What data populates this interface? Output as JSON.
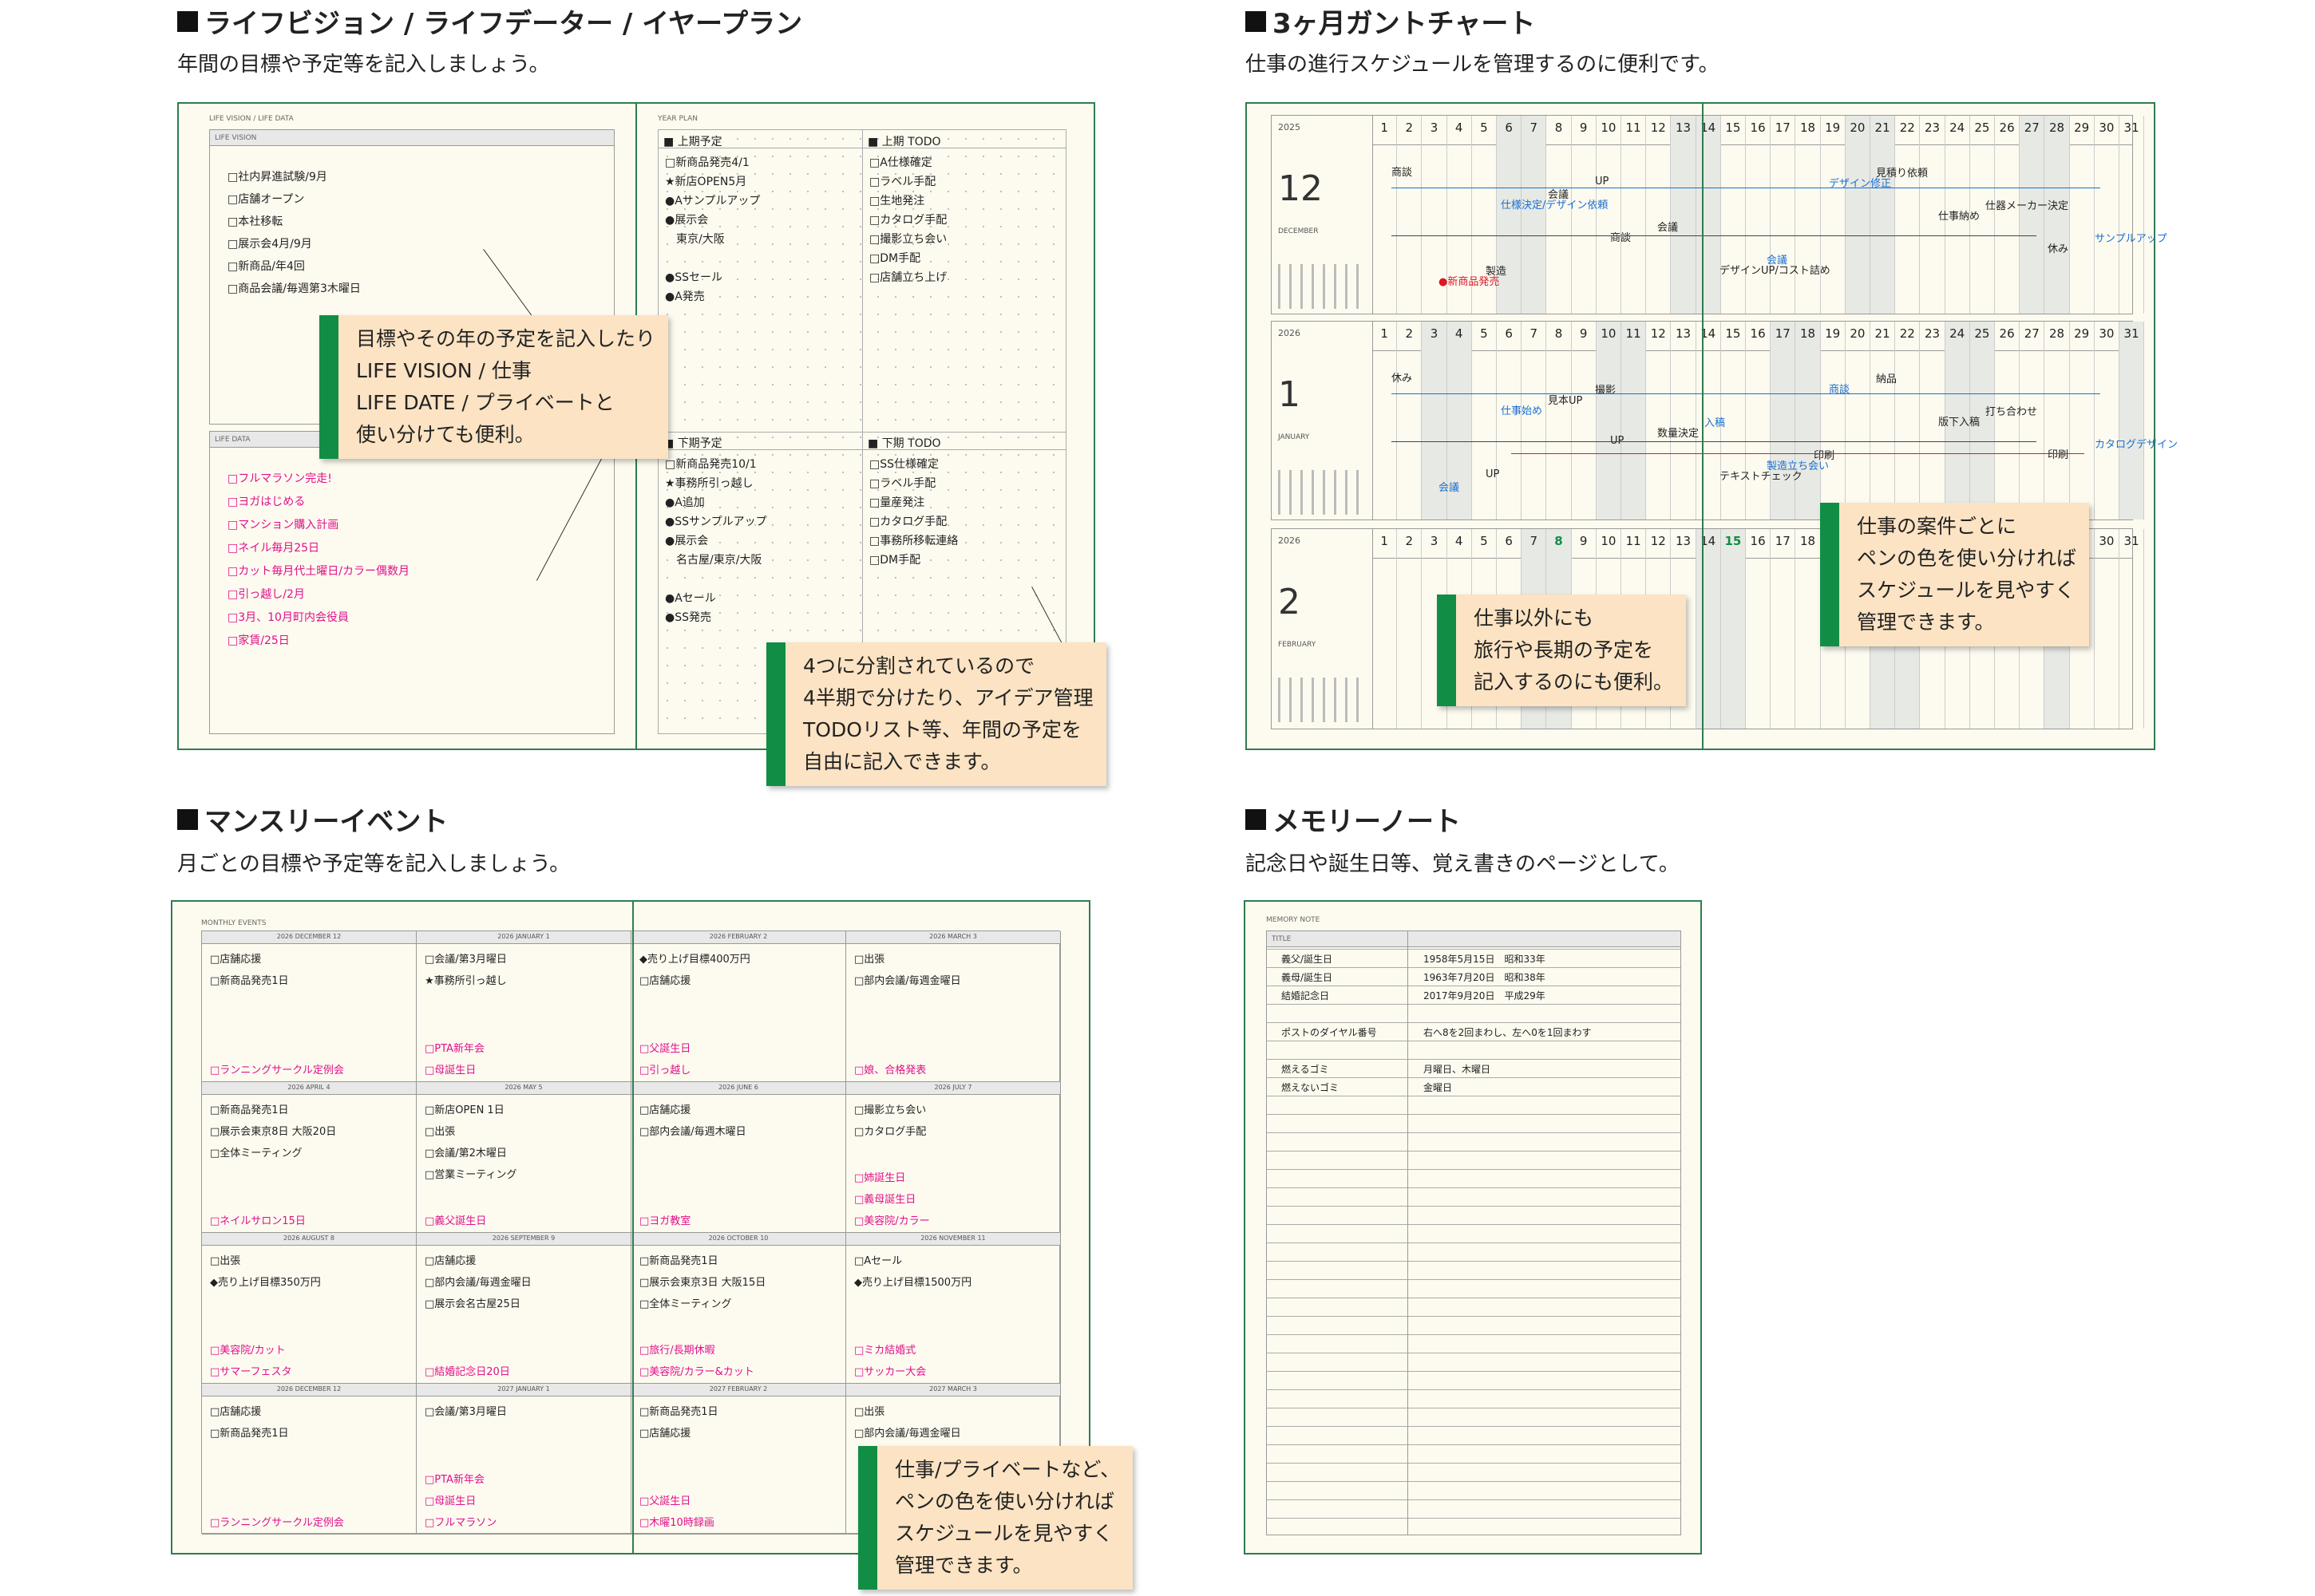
{
  "sections": {
    "life": {
      "title": "ライフビジョン / ライフデーター / イヤープラン",
      "subtitle": "年間の目標や予定等を記入しましょう。"
    },
    "gantt": {
      "title": "3ヶ月ガントチャート",
      "subtitle": "仕事の進行スケジュールを管理するのに便利です。"
    },
    "monthly": {
      "title": "マンスリーイベント",
      "subtitle": "月ごとの目標や予定等を記入しましょう。"
    },
    "memory": {
      "title": "メモリーノート",
      "subtitle": "記念日や誕生日等、覚え書きのページとして。"
    }
  },
  "life_book": {
    "left_header": "LIFE VISION / LIFE DATA",
    "vision_label": "LIFE VISION",
    "vision_items": [
      "□社内昇進試験/9月",
      "□店舗オープン",
      "□本社移転",
      "□展示会4月/9月",
      "□新商品/年4回",
      "□商品会議/毎週第3木曜日"
    ],
    "data_label": "LIFE DATA",
    "data_items": [
      "□フルマラソン完走!",
      "□ヨガはじめる",
      "□マンション購入計画",
      "□ネイル毎月25日",
      "□カット毎月代土曜日/カラー偶数月",
      "□引っ越し/2月",
      "□3月、10月町内会役員",
      "□家賃/25日"
    ],
    "right_header": "YEAR PLAN",
    "q1": "上期予定",
    "q2": "上期 TODO",
    "q3": "下期予定",
    "q4": "下期 TODO",
    "q1_items": [
      "□新商品発売4/1",
      "★新店OPEN5月",
      "●Aサンプルアップ",
      "●展示会",
      "　東京/大阪",
      "",
      "●SSセール",
      "●A発売"
    ],
    "q2_items": [
      "□A仕様確定",
      "□ラベル手配",
      "□生地発注",
      "□カタログ手配",
      "□撮影立ち会い",
      "□DM手配",
      "□店舗立ち上げ"
    ],
    "q3_items": [
      "□新商品発売10/1",
      "★事務所引っ越し",
      "●A追加",
      "●SSサンプルアップ",
      "●展示会",
      "　名古屋/東京/大阪",
      "",
      "●Aセール",
      "●SS発売"
    ],
    "q4_items": [
      "□SS仕様確定",
      "□ラベル手配",
      "□量産発注",
      "□カタログ手配",
      "□事務所移転連絡",
      "□DM手配"
    ],
    "callout1": [
      "目標やその年の予定を記入したり",
      "LIFE VISION / 仕事",
      "LIFE DATE / プライベートと",
      "使い分けても便利。"
    ],
    "callout2": [
      "4つに分割されているので",
      "4半期で分けたり、アイデア管理",
      "TODOリスト等、年間の予定を",
      "自由に記入できます。"
    ]
  },
  "gantt_book": {
    "months": [
      {
        "year": "2025",
        "num": "12",
        "name": "DECEMBER"
      },
      {
        "year": "2026",
        "num": "1",
        "name": "JANUARY"
      },
      {
        "year": "2026",
        "num": "2",
        "name": "FEBRUARY"
      }
    ],
    "days": [
      "1",
      "2",
      "3",
      "4",
      "5",
      "6",
      "7",
      "8",
      "9",
      "10",
      "11",
      "12",
      "13",
      "14",
      "15",
      "16",
      "17",
      "18",
      "19",
      "20",
      "21",
      "22",
      "23",
      "24",
      "25",
      "26",
      "27",
      "28",
      "29",
      "30",
      "31"
    ],
    "row1_notes": [
      "商談",
      "仕様決定/デザイン依頼",
      "商談",
      "デザインUP/コスト詰め",
      "デザイン修正",
      "仕事納め",
      "休み",
      "●新商品発売",
      "会議",
      "会議",
      "会議",
      "見積り依頼",
      "仕器メーカー決定",
      "サンプルアップ",
      "製造",
      "UP"
    ],
    "row2_notes": [
      "休み",
      "仕事始め",
      "UP",
      "テキストチェック",
      "商談",
      "版下入稿",
      "印刷",
      "会議",
      "見本UP",
      "数量決定",
      "製造立ち会い",
      "納品",
      "打ち合わせ",
      "カタログデザイン",
      "UP",
      "撮影",
      "入稿",
      "印刷"
    ],
    "callout1": [
      "仕事以外にも",
      "旅行や長期の予定を",
      "記入するのにも便利。"
    ],
    "callout2": [
      "仕事の案件ごとに",
      "ペンの色を使い分ければ",
      "スケジュールを見やすく",
      "管理できます。"
    ]
  },
  "monthly_book": {
    "header": "MONTHLY EVENTS",
    "cells": [
      {
        "head": "2026 DECEMBER 12",
        "items": [
          "□店舗応援",
          "□新商品発売1日"
        ],
        "pink": [
          "□ランニングサークル定例会"
        ]
      },
      {
        "head": "2026 JANUARY 1",
        "items": [
          "□会議/第3月曜日",
          "★事務所引っ越し"
        ],
        "pink": [
          "□PTA新年会",
          "□母誕生日"
        ]
      },
      {
        "head": "2026 FEBRUARY 2",
        "items": [
          "◆売り上げ目標400万円",
          "□店舗応援"
        ],
        "pink": [
          "□父誕生日",
          "□引っ越し"
        ]
      },
      {
        "head": "2026 MARCH 3",
        "items": [
          "□出張",
          "□部内会議/毎週金曜日"
        ],
        "pink": [
          "□娘、合格発表"
        ]
      },
      {
        "head": "2026 APRIL 4",
        "items": [
          "□新商品発売1日",
          "□展示会東京8日 大阪20日",
          "□全体ミーティング"
        ],
        "pink": [
          "□ネイルサロン15日"
        ]
      },
      {
        "head": "2026 MAY 5",
        "items": [
          "□新店OPEN 1日",
          "□出張",
          "□会議/第2木曜日",
          "□営業ミーティング"
        ],
        "pink": [
          "□義父誕生日"
        ]
      },
      {
        "head": "2026 JUNE 6",
        "items": [
          "□店舗応援",
          "□部内会議/毎週木曜日"
        ],
        "pink": [
          "□ヨガ教室"
        ]
      },
      {
        "head": "2026 JULY 7",
        "items": [
          "□撮影立ち会い",
          "□カタログ手配"
        ],
        "pink": [
          "□姉誕生日",
          "□義母誕生日",
          "□美容院/カラー"
        ]
      },
      {
        "head": "2026 AUGUST 8",
        "items": [
          "□出張",
          "◆売り上げ目標350万円"
        ],
        "pink": [
          "□美容院/カット",
          "□サマーフェスタ"
        ]
      },
      {
        "head": "2026 SEPTEMBER 9",
        "items": [
          "□店舗応援",
          "□部内会議/毎週金曜日",
          "□展示会名古屋25日"
        ],
        "pink": [
          "□結婚記念日20日"
        ]
      },
      {
        "head": "2026 OCTOBER 10",
        "items": [
          "□新商品発売1日",
          "□展示会東京3日 大阪15日",
          "□全体ミーティング"
        ],
        "pink": [
          "□旅行/長期休暇",
          "□美容院/カラー&カット"
        ]
      },
      {
        "head": "2026 NOVEMBER 11",
        "items": [
          "□Aセール",
          "◆売り上げ目標1500万円"
        ],
        "pink": [
          "□ミカ結婚式",
          "□サッカー大会"
        ]
      },
      {
        "head": "2026 DECEMBER 12",
        "items": [
          "□店舗応援",
          "□新商品発売1日"
        ],
        "pink": [
          "□ランニングサークル定例会"
        ]
      },
      {
        "head": "2027 JANUARY 1",
        "items": [
          "□会議/第3月曜日"
        ],
        "pink": [
          "□PTA新年会",
          "□母誕生日",
          "□フルマラソン"
        ]
      },
      {
        "head": "2027 FEBRUARY 2",
        "items": [
          "□新商品発売1日",
          "□店舗応援"
        ],
        "pink": [
          "□父誕生日",
          "□木曜10時録画"
        ]
      },
      {
        "head": "2027 MARCH 3",
        "items": [
          "□出張",
          "□部内会議/毎週金曜日"
        ],
        "pink": []
      }
    ],
    "callout": [
      "仕事/プライベートなど、",
      "ペンの色を使い分ければ",
      "スケジュールを見やすく",
      "管理できます。"
    ]
  },
  "memory_book": {
    "header": "MEMORY NOTE",
    "title_label": "TITLE",
    "rows": [
      {
        "k": "義父/誕生日",
        "v": "1958年5月15日　昭和33年"
      },
      {
        "k": "義母/誕生日",
        "v": "1963年7月20日　昭和38年"
      },
      {
        "k": "結婚記念日",
        "v": "2017年9月20日　平成29年"
      },
      {
        "k": "",
        "v": ""
      },
      {
        "k": "ポストのダイヤル番号",
        "v": "右へ8を2回まわし、左へ0を1回まわす"
      },
      {
        "k": "",
        "v": ""
      },
      {
        "k": "燃えるゴミ",
        "v": "月曜日、木曜日"
      },
      {
        "k": "燃えないゴミ",
        "v": "金曜日"
      }
    ]
  }
}
